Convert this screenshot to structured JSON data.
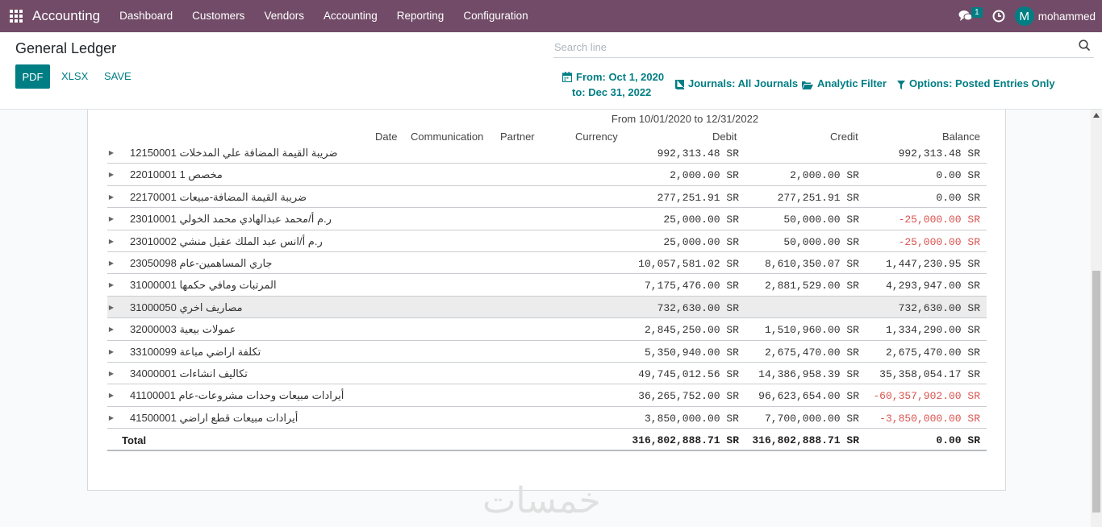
{
  "navbar": {
    "app_name": "Accounting",
    "menu": [
      "Dashboard",
      "Customers",
      "Vendors",
      "Accounting",
      "Reporting",
      "Configuration"
    ],
    "messages_count": "1",
    "user_initial": "M",
    "user_name": "mohammed",
    "bg_color": "#714b67"
  },
  "control_panel": {
    "title": "General Ledger",
    "buttons": {
      "pdf": "PDF",
      "xlsx": "XLSX",
      "save": "SAVE"
    },
    "search_placeholder": "Search line",
    "date_filter": {
      "from": "From: Oct 1, 2020",
      "to": "to: Dec 31, 2022"
    },
    "journals_filter": "Journals: All Journals",
    "analytic_filter": "Analytic Filter",
    "options_filter": "Options: Posted Entries Only",
    "accent_color": "#017e84"
  },
  "report": {
    "period_label": "From 10/01/2020 to 12/31/2022",
    "columns": [
      "Date",
      "Communication",
      "Partner",
      "Currency",
      "Debit",
      "Credit",
      "Balance"
    ],
    "rows": [
      {
        "account": "12150001 ضريبة القيمة المضافة علي المدخلات",
        "debit": "992,313.48 SR",
        "credit": "",
        "balance": "992,313.48 SR",
        "negative": false
      },
      {
        "account": "22010001 مخصص 1",
        "debit": "2,000.00 SR",
        "credit": "2,000.00 SR",
        "balance": "0.00 SR",
        "negative": false
      },
      {
        "account": "22170001 ضريبة القيمة المضافة-مبيعات",
        "debit": "277,251.91 SR",
        "credit": "277,251.91 SR",
        "balance": "0.00 SR",
        "negative": false
      },
      {
        "account": "23010001 ر.م أ/محمد عبدالهادي محمد الخولي",
        "debit": "25,000.00 SR",
        "credit": "50,000.00 SR",
        "balance": "-25,000.00 SR",
        "negative": true
      },
      {
        "account": "23010002 ر.م أ/انس عبد الملك عقيل منشي",
        "debit": "25,000.00 SR",
        "credit": "50,000.00 SR",
        "balance": "-25,000.00 SR",
        "negative": true
      },
      {
        "account": "23050098 جاري المساهمين-عام",
        "debit": "10,057,581.02 SR",
        "credit": "8,610,350.07 SR",
        "balance": "1,447,230.95 SR",
        "negative": false
      },
      {
        "account": "31000001 المرتبات ومافي حكمها",
        "debit": "7,175,476.00 SR",
        "credit": "2,881,529.00 SR",
        "balance": "4,293,947.00 SR",
        "negative": false
      },
      {
        "account": "31000050 مصاريف اخري",
        "debit": "732,630.00 SR",
        "credit": "",
        "balance": "732,630.00 SR",
        "negative": false,
        "highlight": true
      },
      {
        "account": "32000003 عمولات بيعية",
        "debit": "2,845,250.00 SR",
        "credit": "1,510,960.00 SR",
        "balance": "1,334,290.00 SR",
        "negative": false
      },
      {
        "account": "33100099 تكلفة اراضي مباعة",
        "debit": "5,350,940.00 SR",
        "credit": "2,675,470.00 SR",
        "balance": "2,675,470.00 SR",
        "negative": false
      },
      {
        "account": "34000001 تكاليف انشاءات",
        "debit": "49,745,012.56 SR",
        "credit": "14,386,958.39 SR",
        "balance": "35,358,054.17 SR",
        "negative": false
      },
      {
        "account": "41100001 أيرادات مبيعات وحدات مشروعات-عام",
        "debit": "36,265,752.00 SR",
        "credit": "96,623,654.00 SR",
        "balance": "-60,357,902.00 SR",
        "negative": true
      },
      {
        "account": "41500001 أيرادات مبيعات قطع اراضي",
        "debit": "3,850,000.00 SR",
        "credit": "7,700,000.00 SR",
        "balance": "-3,850,000.00 SR",
        "negative": true
      }
    ],
    "total": {
      "label": "Total",
      "debit": "316,802,888.71 SR",
      "credit": "316,802,888.71 SR",
      "balance": "0.00 SR"
    },
    "negative_color": "#d9534f"
  },
  "watermark": "خمسات"
}
